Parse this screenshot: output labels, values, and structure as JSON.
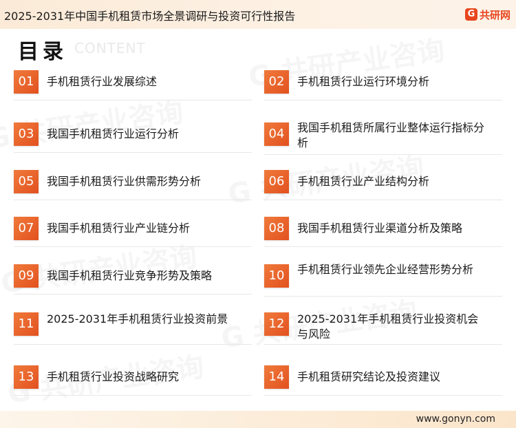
{
  "header": {
    "title": "2025-2031年中国手机租赁市场全景调研与投资可行性报告",
    "logo_text": "共研网",
    "logo_mark": "G"
  },
  "toc": {
    "heading": "目录",
    "subheading": "CONTENT"
  },
  "items": [
    {
      "num": "01",
      "title": "手机租赁行业发展综述"
    },
    {
      "num": "02",
      "title": "手机租赁行业运行环境分析"
    },
    {
      "num": "03",
      "title": "我国手机租赁行业运行分析"
    },
    {
      "num": "04",
      "title": "我国手机租赁所属行业整体运行指标分析"
    },
    {
      "num": "05",
      "title": "我国手机租赁行业供需形势分析"
    },
    {
      "num": "06",
      "title": "手机租赁行业产业结构分析"
    },
    {
      "num": "07",
      "title": "我国手机租赁行业产业链分析"
    },
    {
      "num": "08",
      "title": "我国手机租赁行业渠道分析及策略"
    },
    {
      "num": "09",
      "title": "我国手机租赁行业竞争形势及策略"
    },
    {
      "num": "10",
      "title": "手机租赁行业领先企业经营形势分析"
    },
    {
      "num": "11",
      "title": "2025-2031年手机租赁行业投资前景"
    },
    {
      "num": "12",
      "title": "2025-2031年手机租赁行业投资机会与风险"
    },
    {
      "num": "13",
      "title": "手机租赁行业投资战略研究"
    },
    {
      "num": "14",
      "title": "手机租赁研究结论及投资建议"
    }
  ],
  "footer": {
    "url": "www.gonyn.com"
  },
  "colors": {
    "badge": "#e8581f",
    "brand": "#e8461f"
  }
}
